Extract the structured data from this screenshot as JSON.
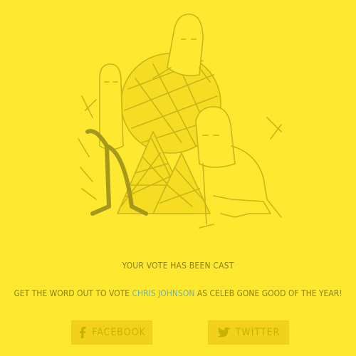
{
  "status": {
    "headline": "YOUR VOTE HAS BEEN CAST"
  },
  "share": {
    "prefix": "GET THE WORD OUT TO VOTE",
    "candidate": "CHRIS JOHNSON",
    "suffix": "AS CELEB GONE GOOD OF THE YEAR!"
  },
  "buttons": {
    "facebook_label": "FACEBOOK",
    "twitter_label": "TWITTER"
  },
  "colors": {
    "background": "#FFE830",
    "text": "#8C8111",
    "candidate_highlight": "#6FB4A4",
    "button_bg": "#F2D11D",
    "button_text": "#C6B300"
  }
}
